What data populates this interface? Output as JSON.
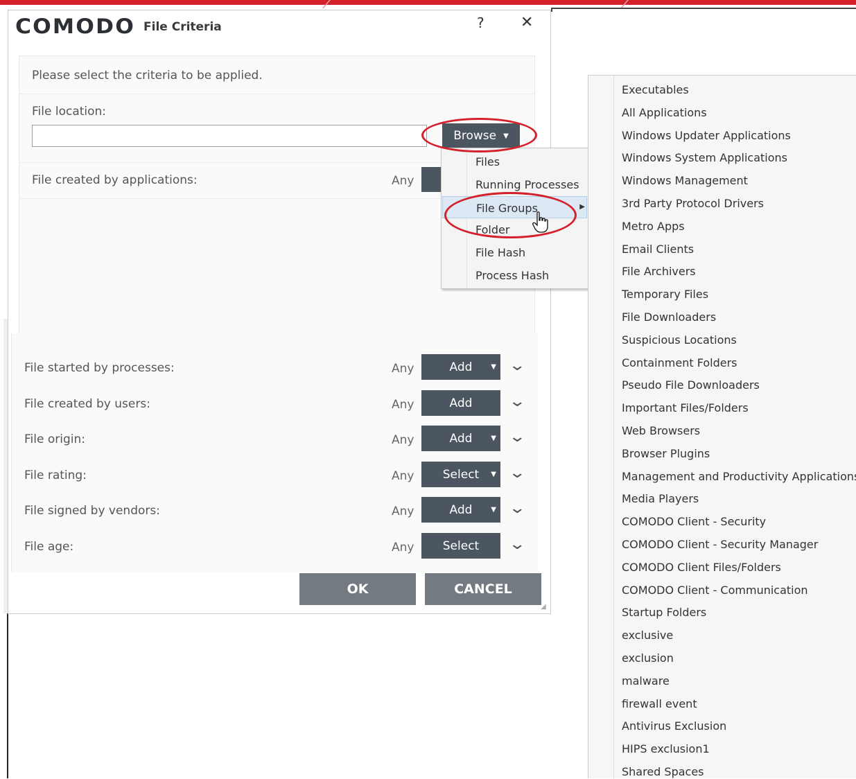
{
  "dialog": {
    "logo": "COMODO",
    "title": "File Criteria",
    "help": "?",
    "close": "✕",
    "intro": "Please select the criteria to be applied.",
    "file_location": {
      "label": "File location:",
      "value": "",
      "browse_label": "Browse"
    },
    "created_by_apps": {
      "label": "File created by applications:",
      "any": "Any"
    },
    "criteria": [
      {
        "label": "File started by processes:",
        "any": "Any",
        "button": "Add",
        "has_caret": true
      },
      {
        "label": "File created by users:",
        "any": "Any",
        "button": "Add",
        "has_caret": false
      },
      {
        "label": "File origin:",
        "any": "Any",
        "button": "Add",
        "has_caret": true
      },
      {
        "label": "File rating:",
        "any": "Any",
        "button": "Select",
        "has_caret": true
      },
      {
        "label": "File signed by vendors:",
        "any": "Any",
        "button": "Add",
        "has_caret": true
      },
      {
        "label": "File age:",
        "any": "Any",
        "button": "Select",
        "has_caret": false
      }
    ],
    "ok": "OK",
    "cancel": "CANCEL"
  },
  "browse_menu": {
    "items": [
      "Files",
      "Running Processes",
      "File Groups",
      "Folder",
      "File Hash",
      "Process Hash"
    ],
    "active": "File Groups"
  },
  "file_groups": [
    "Executables",
    "All Applications",
    "Windows Updater Applications",
    "Windows System Applications",
    "Windows Management",
    "3rd Party Protocol Drivers",
    "Metro Apps",
    "Email Clients",
    "File Archivers",
    "Temporary Files",
    "File Downloaders",
    "Suspicious Locations",
    "Containment Folders",
    "Pseudo File Downloaders",
    "Important Files/Folders",
    "Web Browsers",
    "Browser Plugins",
    "Management and Productivity Applications",
    "Media Players",
    "COMODO Client - Security",
    "COMODO Client - Security Manager",
    "COMODO Client Files/Folders",
    "COMODO Client - Communication",
    "Startup Folders",
    "exclusive",
    "exclusion",
    "malware",
    "firewall event",
    "Antivirus Exclusion",
    "HIPS exclusion1",
    "Shared Spaces"
  ],
  "colors": {
    "button_dark": "#4c5660",
    "button_footer": "#737a81",
    "highlight_red": "#d4202a",
    "menu_active": "#dde8f5"
  }
}
